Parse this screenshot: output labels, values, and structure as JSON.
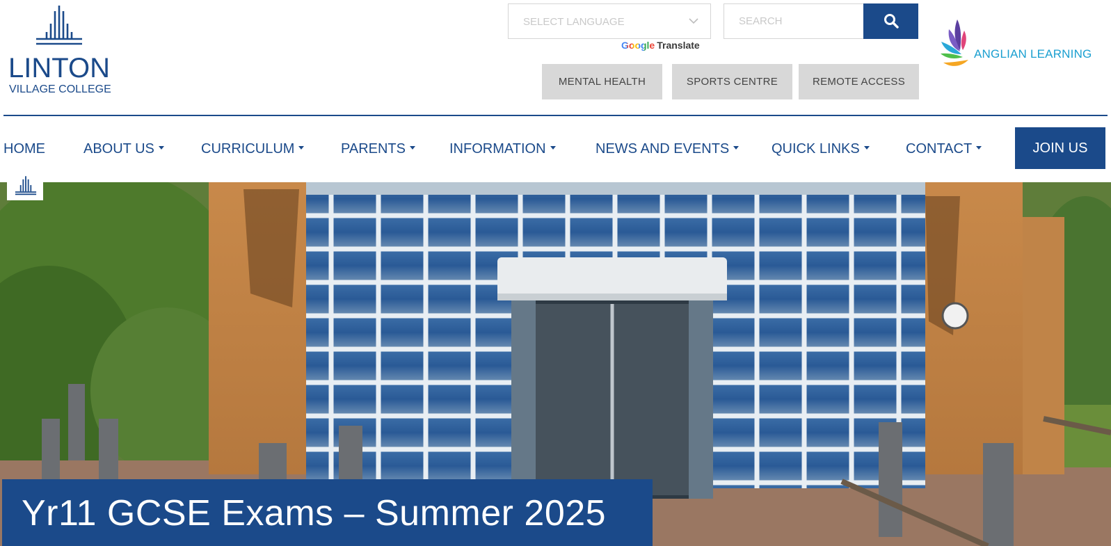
{
  "header": {
    "logo": {
      "name": "LINTON",
      "subtitle": "VILLAGE COLLEGE",
      "icon": "linton-emblem-icon"
    },
    "language_select": {
      "label": "SELECT LANGUAGE",
      "icon": "chevron-down-icon"
    },
    "translate": {
      "brand": "Google",
      "label": "Translate"
    },
    "search": {
      "placeholder": "SEARCH",
      "icon": "search-icon"
    },
    "quick_buttons": [
      "MENTAL HEALTH",
      "SPORTS CENTRE",
      "REMOTE ACCESS"
    ],
    "partner": {
      "name": "ANGLIAN LEARNING",
      "icon": "anglian-learning-leaves-icon"
    }
  },
  "nav": {
    "items": [
      {
        "label": "HOME",
        "dropdown": false
      },
      {
        "label": "ABOUT US",
        "dropdown": true
      },
      {
        "label": "CURRICULUM",
        "dropdown": true
      },
      {
        "label": "PARENTS",
        "dropdown": true
      },
      {
        "label": "INFORMATION",
        "dropdown": true
      },
      {
        "label": "NEWS AND EVENTS",
        "dropdown": true
      },
      {
        "label": "QUICK LINKS",
        "dropdown": true
      },
      {
        "label": "CONTACT",
        "dropdown": true
      }
    ],
    "join_label": "JOIN US"
  },
  "hero": {
    "caption": "Yr11 GCSE Exams – Summer 2025"
  },
  "colors": {
    "brand_blue": "#1b4a8a",
    "quick_button_bg": "#d8d8d8",
    "anglian_text": "#1a9fd0"
  }
}
